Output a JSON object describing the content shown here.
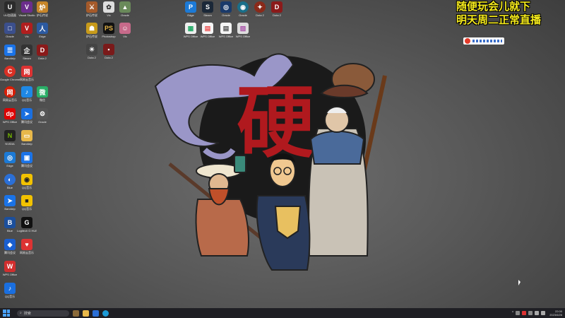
{
  "overlay": {
    "line1": "随便玩会儿就下",
    "line2": "明天周二正常直播"
  },
  "wallpaper": {
    "calligraphy": "硬"
  },
  "desktop_icons": [
    {
      "label": "UU加速器",
      "color": "#2b2b2b",
      "glyph": "U"
    },
    {
      "label": "Visual Studio",
      "color": "#6b2d8c",
      "glyph": "V"
    },
    {
      "label": "炉石传说",
      "color": "#c7862a",
      "glyph": "炉"
    },
    {
      "label": "Dota 2",
      "color": "#8b1a1a",
      "glyph": "D"
    },
    {
      "label": "Edge",
      "color": "#1c7ad6",
      "glyph": "e"
    },
    {
      "label": "Vlc",
      "color": "#e06a10",
      "glyph": "V"
    },
    {
      "label": "Oracle",
      "color": "#333",
      "glyph": "O"
    },
    {
      "label": "Steam",
      "color": "#1b2838",
      "glyph": "S"
    },
    {
      "label": "Google Chrome",
      "color": "#d93025",
      "glyph": "C"
    },
    {
      "label": "QQ音乐",
      "color": "#f2c200",
      "glyph": "Q"
    },
    {
      "label": "网易云音乐",
      "color": "#d81e06",
      "glyph": "网"
    },
    {
      "label": "微信",
      "color": "#2aae67",
      "glyph": "微"
    },
    {
      "label": "NVIDIA",
      "color": "#222",
      "glyph": "N"
    },
    {
      "label": "WPS Office",
      "color": "#d12e2e",
      "glyph": "W"
    },
    {
      "label": "腾讯会议",
      "color": "#1a6fe0",
      "glyph": "T"
    },
    {
      "label": "Logitech G HUB",
      "color": "#111",
      "glyph": "G"
    },
    {
      "label": "Bandizip",
      "color": "#1a73e8",
      "glyph": "B"
    },
    {
      "label": "Blue",
      "color": "#1c4f9c",
      "glyph": "B"
    },
    {
      "label": "Photoshop",
      "color": "#111",
      "glyph": "Ps"
    }
  ],
  "taskbar": {
    "search_placeholder": "搜索",
    "clock_time": "22:00",
    "clock_date": "2023/6/26"
  },
  "colors": {
    "overlay_text": "#f5ea1c",
    "calligraphy": "#b0191e",
    "taskbar": "#1f1f24"
  }
}
